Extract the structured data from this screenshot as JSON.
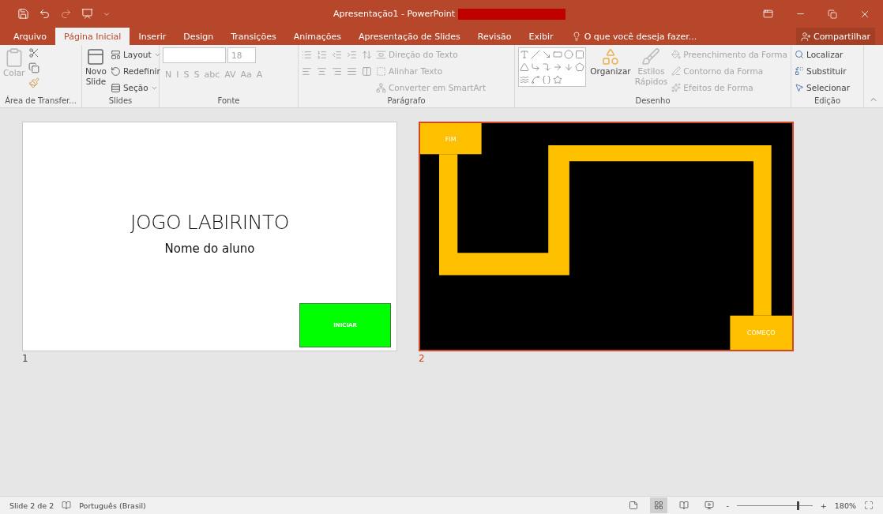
{
  "window": {
    "title": "Apresentação1 - PowerPoint",
    "title_redacted": true
  },
  "tabs": [
    {
      "label": "Arquivo",
      "selected": false
    },
    {
      "label": "Página Inicial",
      "selected": true
    },
    {
      "label": "Inserir",
      "selected": false
    },
    {
      "label": "Design",
      "selected": false
    },
    {
      "label": "Transições",
      "selected": false
    },
    {
      "label": "Animações",
      "selected": false
    },
    {
      "label": "Apresentação de Slides",
      "selected": false
    },
    {
      "label": "Revisão",
      "selected": false
    },
    {
      "label": "Exibir",
      "selected": false
    }
  ],
  "tell_me": {
    "placeholder": "O que você deseja fazer..."
  },
  "share_button": "Compartilhar",
  "ribbon": {
    "clipboard": {
      "label": "Área de Transfer...",
      "paste": {
        "label": "Colar",
        "disabled": true
      }
    },
    "slides": {
      "label": "Slides",
      "new_slide": [
        "Novo",
        "Slide"
      ],
      "items": [
        {
          "label": "Layout",
          "dropdown": true
        },
        {
          "label": "Redefinir",
          "dropdown": false
        },
        {
          "label": "Seção",
          "dropdown": true
        }
      ]
    },
    "font": {
      "label": "Fonte",
      "size": "18",
      "format_buttons": [
        "N",
        "I",
        "S",
        "S",
        "abc",
        "AV",
        "Aa",
        "A"
      ],
      "disabled": true
    },
    "paragraph": {
      "label": "Parágrafo",
      "items": [
        {
          "label": "Direção do Texto",
          "disabled": true
        },
        {
          "label": "Alinhar Texto",
          "disabled": true
        },
        {
          "label": "Converter em SmartArt",
          "disabled": true
        }
      ]
    },
    "drawing": {
      "label": "Desenho",
      "arrange": "Organizar",
      "quick_styles": {
        "label": [
          "Estilos",
          "Rápidos"
        ],
        "disabled": true
      },
      "items": [
        {
          "label": "Preenchimento da Forma",
          "disabled": true
        },
        {
          "label": "Contorno da Forma",
          "disabled": true
        },
        {
          "label": "Efeitos de Forma",
          "disabled": true
        }
      ]
    },
    "editing": {
      "label": "Edição",
      "items": [
        {
          "label": "Localizar",
          "disabled": false
        },
        {
          "label": "Substituir",
          "disabled": false
        },
        {
          "label": "Selecionar",
          "disabled": false
        }
      ]
    }
  },
  "slides": [
    {
      "number": "1",
      "selected": false,
      "kind": "title",
      "title": "JOGO LABIRINTO",
      "subtitle": "Nome do aluno",
      "button": "INICIAR"
    },
    {
      "number": "2",
      "selected": true,
      "kind": "maze",
      "end_label": "FIM",
      "start_label": "COMEÇO"
    }
  ],
  "status_bar": {
    "slide": "Slide 2 de 2",
    "language": "Português (Brasil)",
    "views": [
      {
        "selected": false
      },
      {
        "selected": true
      },
      {
        "selected": false
      },
      {
        "selected": false
      }
    ],
    "zoom_out": "-",
    "zoom_in": "+",
    "zoom": {
      "level": 0.79
    },
    "zoom_text": "180%"
  }
}
